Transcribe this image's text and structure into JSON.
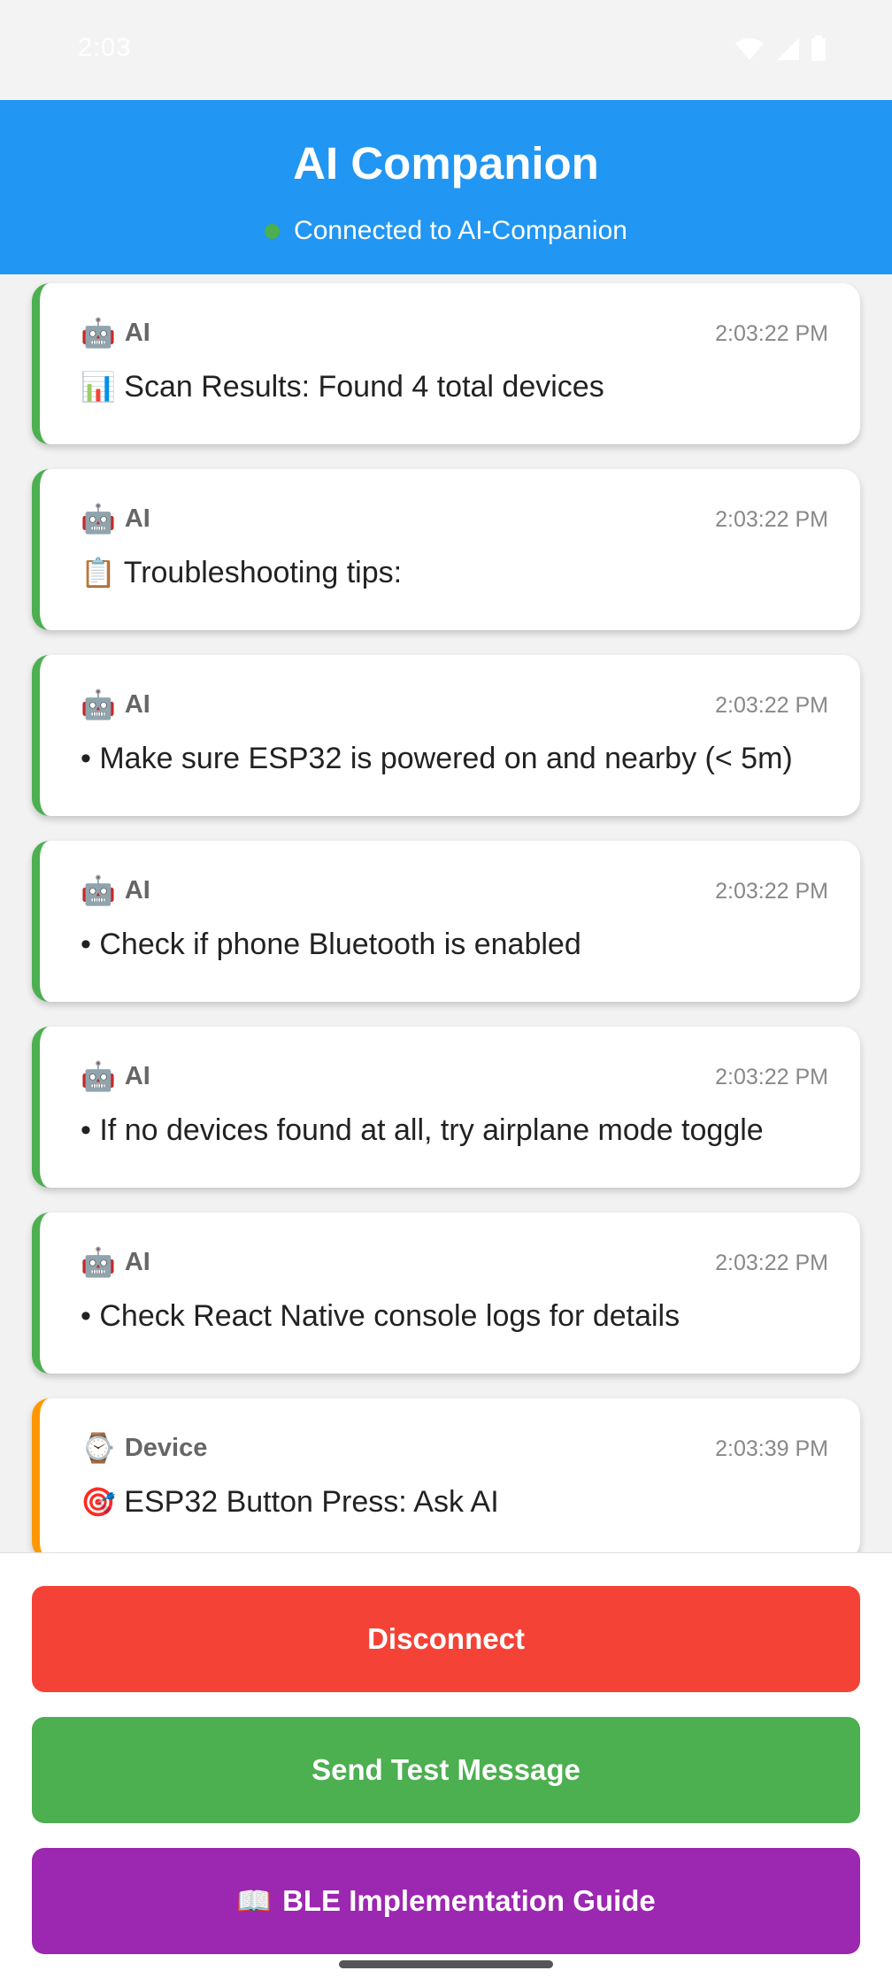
{
  "status_bar": {
    "time": "2:03"
  },
  "header": {
    "title": "AI Companion",
    "status": "Connected to AI-Companion",
    "status_color": "#4caf50",
    "background": "#2196f3"
  },
  "messages": [
    {
      "sender_icon": "🤖",
      "sender": "AI",
      "time": "2:03:22 PM",
      "icon": "📊",
      "text": "Scan Results: Found 4 total devices"
    },
    {
      "sender_icon": "🤖",
      "sender": "AI",
      "time": "2:03:22 PM",
      "icon": "📋",
      "text": "Troubleshooting tips:"
    },
    {
      "sender_icon": "🤖",
      "sender": "AI",
      "time": "2:03:22 PM",
      "icon": "",
      "text": "• Make sure ESP32 is powered on and nearby (< 5m)"
    },
    {
      "sender_icon": "🤖",
      "sender": "AI",
      "time": "2:03:22 PM",
      "icon": "",
      "text": "• Check if phone Bluetooth is enabled"
    },
    {
      "sender_icon": "🤖",
      "sender": "AI",
      "time": "2:03:22 PM",
      "icon": "",
      "text": "• If no devices found at all, try airplane mode toggle"
    },
    {
      "sender_icon": "🤖",
      "sender": "AI",
      "time": "2:03:22 PM",
      "icon": "",
      "text": "• Check React Native console logs for details"
    },
    {
      "sender_icon": "⌚",
      "sender": "Device",
      "time": "2:03:39 PM",
      "icon": "🎯",
      "text": "ESP32 Button Press: Ask AI"
    }
  ],
  "buttons": {
    "disconnect": "Disconnect",
    "send_test": "Send Test Message",
    "guide_icon": "📖",
    "guide": "BLE Implementation Guide"
  },
  "colors": {
    "ai_border": "#4caf50",
    "device_border": "#ff9800",
    "disconnect": "#f44336",
    "send_test": "#4caf50",
    "guide": "#9c27b0"
  }
}
